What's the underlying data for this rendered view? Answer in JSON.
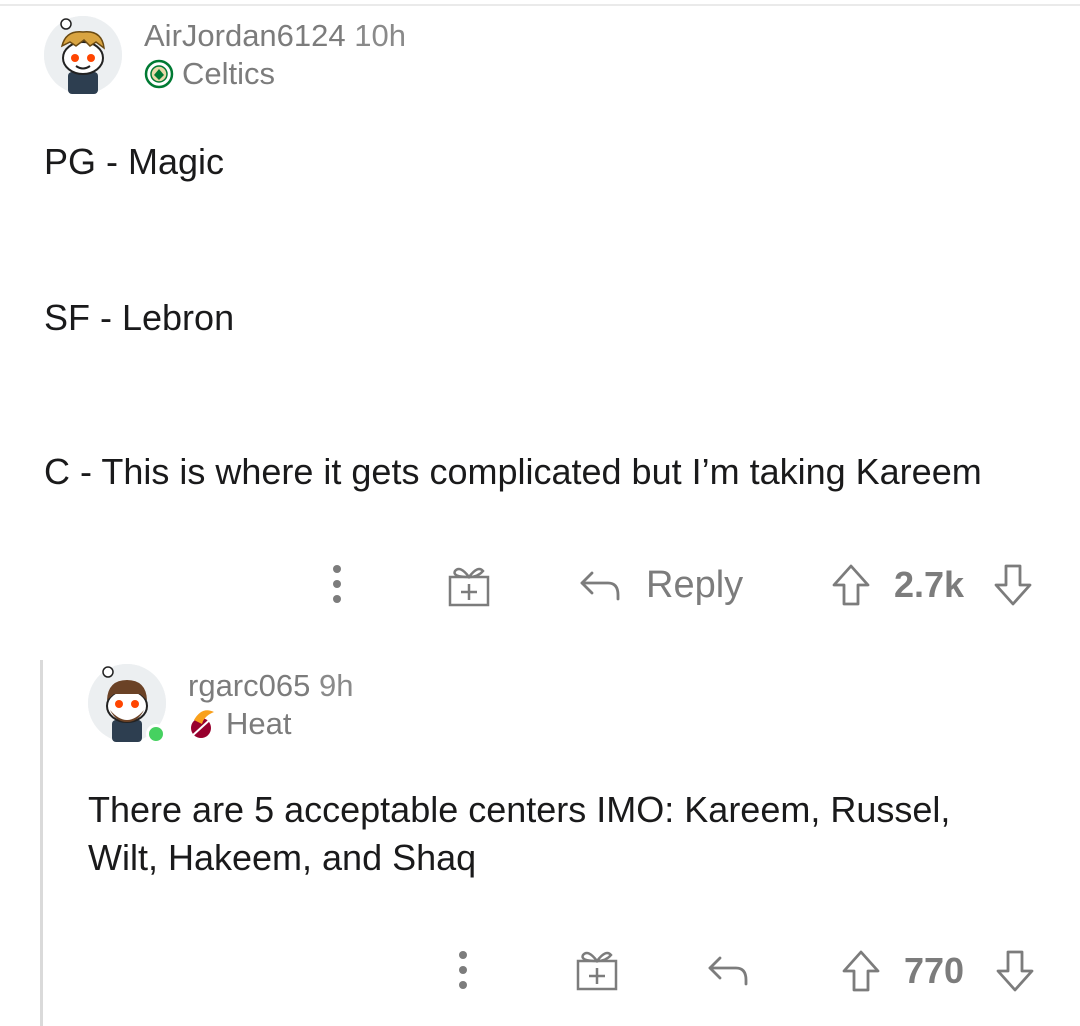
{
  "colors": {
    "text": "#1a1a1b",
    "meta": "#7c7c7c",
    "online": "#46d160",
    "thread_line": "#dadada"
  },
  "comments": [
    {
      "username": "AirJordan6124",
      "age": "10h",
      "flair": {
        "icon": "celtics-logo-icon",
        "text": "Celtics"
      },
      "lines": [
        "PG - Magic",
        "SF - Lebron",
        "C - This is where it gets complicated but I’m taking Kareem"
      ],
      "actions": {
        "reply_label": "Reply",
        "score": "2.7k"
      }
    },
    {
      "username": "rgarc065",
      "age": "9h",
      "flair": {
        "icon": "heat-logo-icon",
        "text": "Heat"
      },
      "lines": [
        "There are 5 acceptable centers IMO: Kareem, Russel,",
        "Wilt, Hakeem, and Shaq"
      ],
      "actions": {
        "score": "770"
      }
    }
  ]
}
